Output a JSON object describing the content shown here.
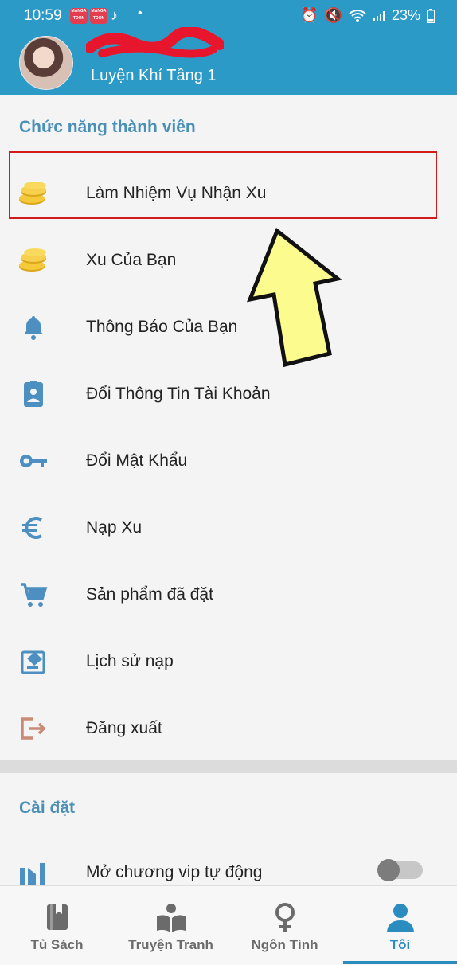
{
  "status_bar": {
    "time": "10:59",
    "app_badge": "MANGA TOON",
    "battery": "23%"
  },
  "header": {
    "level": "Luyện Khí Tầng 1"
  },
  "member_section": {
    "title": "Chức năng thành viên",
    "items": [
      {
        "label": "Làm Nhiệm Vụ Nhận Xu",
        "icon": "coins-icon"
      },
      {
        "label": "Xu Của Bạn",
        "icon": "coins-icon"
      },
      {
        "label": "Thông Báo Của Bạn",
        "icon": "bell-icon"
      },
      {
        "label": "Đổi Thông Tin Tài Khoản",
        "icon": "id-badge-icon"
      },
      {
        "label": "Đổi Mật Khẩu",
        "icon": "key-icon"
      },
      {
        "label": "Nạp Xu",
        "icon": "euro-icon"
      },
      {
        "label": "Sản phẩm đã đặt",
        "icon": "cart-icon"
      },
      {
        "label": "Lịch sử nạp",
        "icon": "history-icon"
      },
      {
        "label": "Đăng xuất",
        "icon": "logout-icon"
      }
    ]
  },
  "settings_section": {
    "title": "Cài đặt",
    "items": [
      {
        "label": "Mở chương vip tự động",
        "icon": "chapter-icon",
        "toggle": false
      }
    ]
  },
  "bottom_nav": [
    {
      "label": "Tủ Sách",
      "icon": "book-icon",
      "active": false
    },
    {
      "label": "Truyện Tranh",
      "icon": "open-book-icon",
      "active": false
    },
    {
      "label": "Ngôn Tình",
      "icon": "female-icon",
      "active": false
    },
    {
      "label": "Tôi",
      "icon": "user-icon",
      "active": true
    }
  ],
  "colors": {
    "header": "#2b9ac7",
    "accent": "#2b8cc0",
    "highlight_border": "#d11b1b",
    "arrow_fill": "#fbfb8e"
  }
}
